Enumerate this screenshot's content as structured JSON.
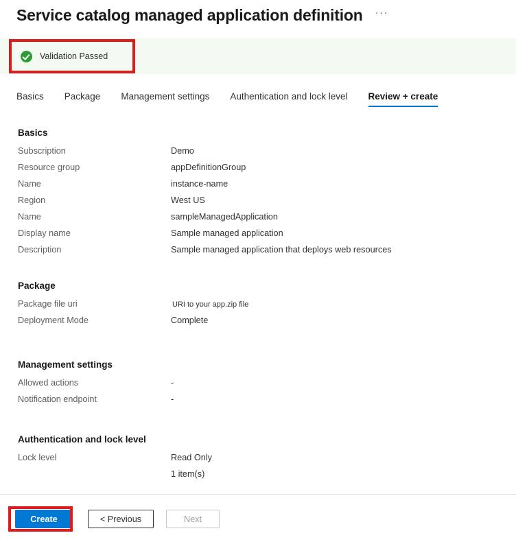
{
  "header": {
    "title": "Service catalog managed application definition",
    "more_options": "···"
  },
  "validation": {
    "icon": "check-circle-icon",
    "text": "Validation Passed",
    "background_color": "#f3faf1",
    "icon_color": "#2e9b34",
    "annotation_color": "#e01b1b"
  },
  "tabs": [
    {
      "label": "Basics",
      "selected": false
    },
    {
      "label": "Package",
      "selected": false
    },
    {
      "label": "Management settings",
      "selected": false
    },
    {
      "label": "Authentication and lock level",
      "selected": false
    },
    {
      "label": "Review + create",
      "selected": true
    }
  ],
  "accent_color": "#0078d4",
  "sections": [
    {
      "title": "Basics",
      "rows": [
        {
          "label": "Subscription",
          "value": "Demo"
        },
        {
          "label": "Resource group",
          "value": "appDefinitionGroup"
        },
        {
          "label": "Name",
          "value": "instance-name"
        },
        {
          "label": "Region",
          "value": "West US"
        },
        {
          "label": "Name",
          "value": "sampleManagedApplication"
        },
        {
          "label": "Display name",
          "value": "Sample managed application"
        },
        {
          "label": "Description",
          "value": "Sample managed application that deploys web resources"
        }
      ]
    },
    {
      "title": "Package",
      "rows": [
        {
          "label": "Package file uri",
          "value": "URI to your app.zip file",
          "small": true
        },
        {
          "label": "Deployment Mode",
          "value": "Complete"
        }
      ]
    },
    {
      "title": "Management settings",
      "rows": [
        {
          "label": "Allowed actions",
          "value": "-"
        },
        {
          "label": "Notification endpoint",
          "value": "-"
        }
      ]
    },
    {
      "title": "Authentication and lock level",
      "rows": [
        {
          "label": "Lock level",
          "value": "Read Only"
        },
        {
          "label": "",
          "value": "1 item(s)"
        }
      ]
    }
  ],
  "footer": {
    "create_label": "Create",
    "previous_label": "< Previous",
    "next_label": "Next",
    "next_disabled": true
  }
}
